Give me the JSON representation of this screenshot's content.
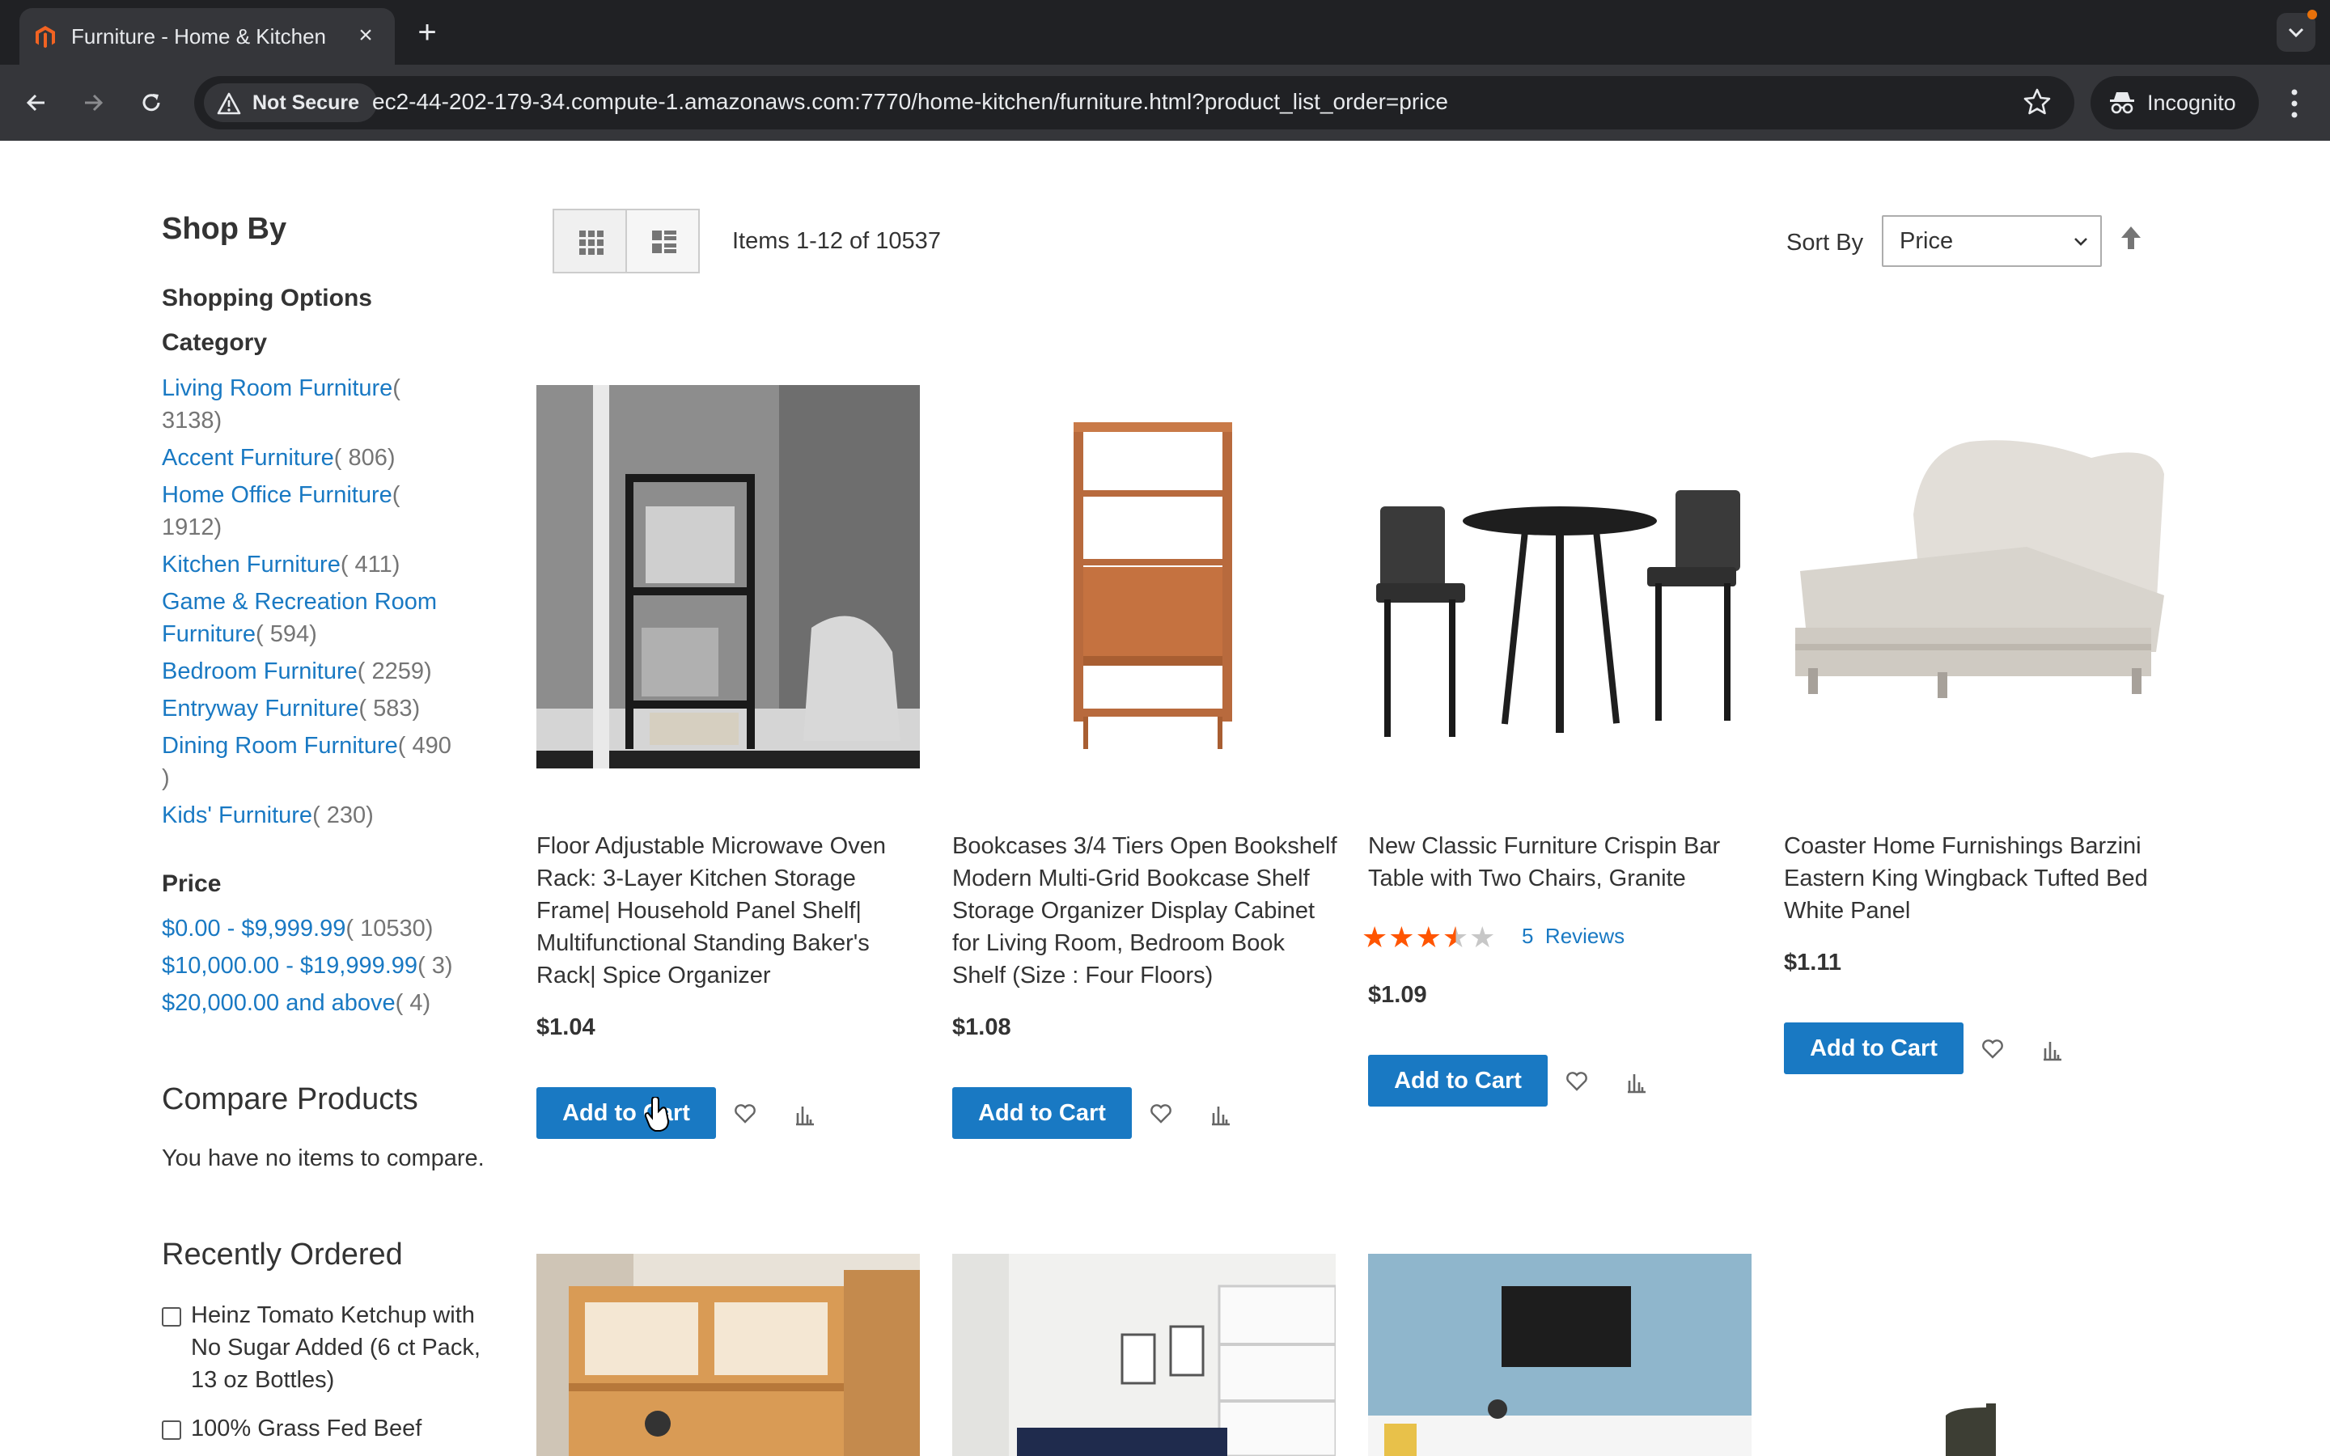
{
  "browser": {
    "tab_title": "Furniture - Home & Kitchen",
    "new_tab_label": "+",
    "security_label": "Not Secure",
    "url": "ec2-44-202-179-34.compute-1.amazonaws.com:7770/home-kitchen/furniture.html?product_list_order=price",
    "profile_label": "Incognito",
    "accent_color": "#e8710a"
  },
  "sidebar": {
    "title": "Shop By",
    "options_heading": "Shopping Options",
    "category_heading": "Category",
    "categories": [
      {
        "label": "Living Room Furniture",
        "count_a": "(",
        "count_b": "3138)"
      },
      {
        "label": "Accent Furniture",
        "count_a": "( 806)"
      },
      {
        "label": "Home Office Furniture",
        "count_a": "(",
        "count_b": "1912)"
      },
      {
        "label": "Kitchen Furniture",
        "count_a": "( 411)"
      },
      {
        "label": "Game & Recreation Room",
        "label_b": "Furniture",
        "count_a": "( 594)"
      },
      {
        "label": "Bedroom Furniture",
        "count_a": "( 2259)"
      },
      {
        "label": "Entryway Furniture",
        "count_a": "( 583)"
      },
      {
        "label": "Dining Room Furniture",
        "count_a": "( 490",
        "count_b": ")"
      },
      {
        "label": "Kids' Furniture",
        "count_a": "( 230)"
      }
    ],
    "price_heading": "Price",
    "prices": [
      {
        "label": "$0.00 - $9,999.99",
        "count": "( 10530)"
      },
      {
        "label": "$10,000.00 - $19,999.99",
        "count": "( 3)"
      },
      {
        "label": "$20,000.00 and above",
        "count": "( 4)"
      }
    ],
    "compare_title": "Compare Products",
    "compare_empty": "You have no items to compare.",
    "recent_title": "Recently Ordered",
    "recent_items": [
      "Heinz Tomato Ketchup with No Sugar Added (6 ct Pack, 13 oz Bottles)",
      "100% Grass Fed Beef"
    ]
  },
  "toolbar": {
    "amount": "Items 1-12 of 10537",
    "sort_label": "Sort By",
    "sort_value": "Price"
  },
  "products": [
    {
      "name": "Floor Adjustable Microwave Oven Rack: 3-Layer Kitchen Storage Frame| Household Panel Shelf| Multifunctional Standing Baker's Rack| Spice Organizer",
      "price": "$1.04",
      "cta": "Add to Cart"
    },
    {
      "name": "Bookcases 3/4 Tiers Open Bookshelf Modern Multi-Grid Bookcase Shelf Storage Organizer Display Cabinet for Living Room, Bedroom Book Shelf (Size : Four Floors)",
      "price": "$1.08",
      "cta": "Add to Cart"
    },
    {
      "name": "New Classic Furniture Crispin Bar Table with Two Chairs, Granite",
      "price": "$1.09",
      "cta": "Add to Cart",
      "rating": 3.5,
      "reviews_count": "5",
      "reviews_label": "Reviews"
    },
    {
      "name": "Coaster Home Furnishings Barzini Eastern King Wingback Tufted Bed White Panel",
      "price": "$1.11",
      "cta": "Add to Cart"
    }
  ],
  "colors": {
    "link": "#1979c3",
    "button": "#1979c3",
    "star_filled": "#ff5501",
    "star_empty": "#c7c7c7"
  }
}
